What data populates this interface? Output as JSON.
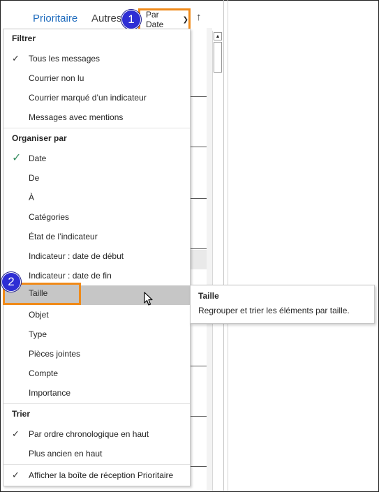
{
  "tabs": {
    "focused": "Prioritaire",
    "other": "Autres"
  },
  "sort_button": {
    "label": "Par Date"
  },
  "step_badges": [
    "1",
    "2"
  ],
  "menu": {
    "filter": {
      "header": "Filtrer",
      "items": [
        {
          "label": "Tous les messages",
          "checked": true
        },
        {
          "label": "Courrier non lu",
          "checked": false
        },
        {
          "label": "Courrier marqué d’un indicateur",
          "checked": false
        },
        {
          "label": "Messages avec mentions",
          "checked": false
        }
      ]
    },
    "arrange": {
      "header": "Organiser par",
      "items": [
        {
          "label": "Date",
          "checked": true
        },
        {
          "label": "De",
          "checked": false
        },
        {
          "label": "À",
          "checked": false
        },
        {
          "label": "Catégories",
          "checked": false
        },
        {
          "label": "État de l’indicateur",
          "checked": false
        },
        {
          "label": "Indicateur : date de début",
          "checked": false
        },
        {
          "label": "Indicateur : date de fin",
          "checked": false
        },
        {
          "label": "Taille",
          "checked": false,
          "highlighted": true
        },
        {
          "label": "Objet",
          "checked": false
        },
        {
          "label": "Type",
          "checked": false
        },
        {
          "label": "Pièces jointes",
          "checked": false
        },
        {
          "label": "Compte",
          "checked": false
        },
        {
          "label": "Importance",
          "checked": false
        }
      ]
    },
    "sort": {
      "header": "Trier",
      "items": [
        {
          "label": "Par ordre chronologique en haut",
          "checked": true
        },
        {
          "label": "Plus ancien en haut",
          "checked": false
        }
      ]
    },
    "show_focused": {
      "label": "Afficher la boîte de réception Prioritaire",
      "checked": true
    }
  },
  "tooltip": {
    "title": "Taille",
    "description": "Regrouper et trier les éléments par taille."
  },
  "colors": {
    "accent_orange": "#f08a19",
    "badge_blue": "#2e2ed4",
    "focused_tab": "#1e6bbd",
    "check_green": "#3a8f63",
    "highlight": "#c6c6c6"
  }
}
